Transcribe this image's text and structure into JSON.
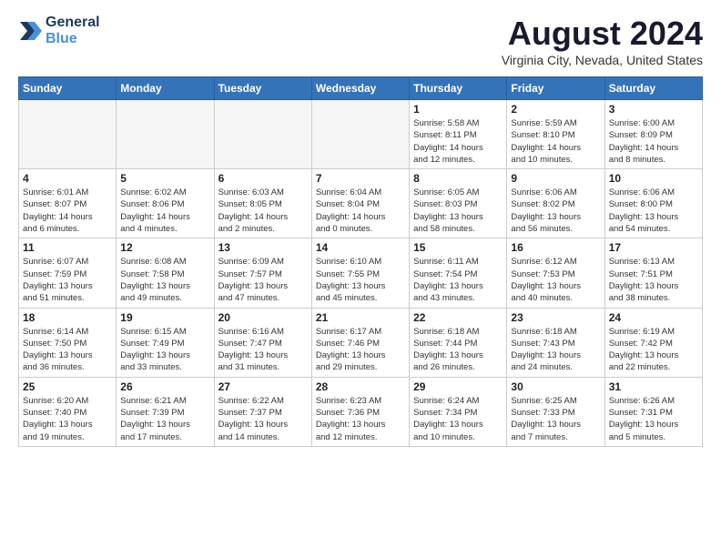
{
  "header": {
    "logo_line1": "General",
    "logo_line2": "Blue",
    "month": "August 2024",
    "location": "Virginia City, Nevada, United States"
  },
  "columns": [
    "Sunday",
    "Monday",
    "Tuesday",
    "Wednesday",
    "Thursday",
    "Friday",
    "Saturday"
  ],
  "weeks": [
    [
      {
        "num": "",
        "detail": "",
        "empty": true
      },
      {
        "num": "",
        "detail": "",
        "empty": true
      },
      {
        "num": "",
        "detail": "",
        "empty": true
      },
      {
        "num": "",
        "detail": "",
        "empty": true
      },
      {
        "num": "1",
        "detail": "Sunrise: 5:58 AM\nSunset: 8:11 PM\nDaylight: 14 hours\nand 12 minutes."
      },
      {
        "num": "2",
        "detail": "Sunrise: 5:59 AM\nSunset: 8:10 PM\nDaylight: 14 hours\nand 10 minutes."
      },
      {
        "num": "3",
        "detail": "Sunrise: 6:00 AM\nSunset: 8:09 PM\nDaylight: 14 hours\nand 8 minutes."
      }
    ],
    [
      {
        "num": "4",
        "detail": "Sunrise: 6:01 AM\nSunset: 8:07 PM\nDaylight: 14 hours\nand 6 minutes."
      },
      {
        "num": "5",
        "detail": "Sunrise: 6:02 AM\nSunset: 8:06 PM\nDaylight: 14 hours\nand 4 minutes."
      },
      {
        "num": "6",
        "detail": "Sunrise: 6:03 AM\nSunset: 8:05 PM\nDaylight: 14 hours\nand 2 minutes."
      },
      {
        "num": "7",
        "detail": "Sunrise: 6:04 AM\nSunset: 8:04 PM\nDaylight: 14 hours\nand 0 minutes."
      },
      {
        "num": "8",
        "detail": "Sunrise: 6:05 AM\nSunset: 8:03 PM\nDaylight: 13 hours\nand 58 minutes."
      },
      {
        "num": "9",
        "detail": "Sunrise: 6:06 AM\nSunset: 8:02 PM\nDaylight: 13 hours\nand 56 minutes."
      },
      {
        "num": "10",
        "detail": "Sunrise: 6:06 AM\nSunset: 8:00 PM\nDaylight: 13 hours\nand 54 minutes."
      }
    ],
    [
      {
        "num": "11",
        "detail": "Sunrise: 6:07 AM\nSunset: 7:59 PM\nDaylight: 13 hours\nand 51 minutes."
      },
      {
        "num": "12",
        "detail": "Sunrise: 6:08 AM\nSunset: 7:58 PM\nDaylight: 13 hours\nand 49 minutes."
      },
      {
        "num": "13",
        "detail": "Sunrise: 6:09 AM\nSunset: 7:57 PM\nDaylight: 13 hours\nand 47 minutes."
      },
      {
        "num": "14",
        "detail": "Sunrise: 6:10 AM\nSunset: 7:55 PM\nDaylight: 13 hours\nand 45 minutes."
      },
      {
        "num": "15",
        "detail": "Sunrise: 6:11 AM\nSunset: 7:54 PM\nDaylight: 13 hours\nand 43 minutes."
      },
      {
        "num": "16",
        "detail": "Sunrise: 6:12 AM\nSunset: 7:53 PM\nDaylight: 13 hours\nand 40 minutes."
      },
      {
        "num": "17",
        "detail": "Sunrise: 6:13 AM\nSunset: 7:51 PM\nDaylight: 13 hours\nand 38 minutes."
      }
    ],
    [
      {
        "num": "18",
        "detail": "Sunrise: 6:14 AM\nSunset: 7:50 PM\nDaylight: 13 hours\nand 36 minutes."
      },
      {
        "num": "19",
        "detail": "Sunrise: 6:15 AM\nSunset: 7:49 PM\nDaylight: 13 hours\nand 33 minutes."
      },
      {
        "num": "20",
        "detail": "Sunrise: 6:16 AM\nSunset: 7:47 PM\nDaylight: 13 hours\nand 31 minutes."
      },
      {
        "num": "21",
        "detail": "Sunrise: 6:17 AM\nSunset: 7:46 PM\nDaylight: 13 hours\nand 29 minutes."
      },
      {
        "num": "22",
        "detail": "Sunrise: 6:18 AM\nSunset: 7:44 PM\nDaylight: 13 hours\nand 26 minutes."
      },
      {
        "num": "23",
        "detail": "Sunrise: 6:18 AM\nSunset: 7:43 PM\nDaylight: 13 hours\nand 24 minutes."
      },
      {
        "num": "24",
        "detail": "Sunrise: 6:19 AM\nSunset: 7:42 PM\nDaylight: 13 hours\nand 22 minutes."
      }
    ],
    [
      {
        "num": "25",
        "detail": "Sunrise: 6:20 AM\nSunset: 7:40 PM\nDaylight: 13 hours\nand 19 minutes."
      },
      {
        "num": "26",
        "detail": "Sunrise: 6:21 AM\nSunset: 7:39 PM\nDaylight: 13 hours\nand 17 minutes."
      },
      {
        "num": "27",
        "detail": "Sunrise: 6:22 AM\nSunset: 7:37 PM\nDaylight: 13 hours\nand 14 minutes."
      },
      {
        "num": "28",
        "detail": "Sunrise: 6:23 AM\nSunset: 7:36 PM\nDaylight: 13 hours\nand 12 minutes."
      },
      {
        "num": "29",
        "detail": "Sunrise: 6:24 AM\nSunset: 7:34 PM\nDaylight: 13 hours\nand 10 minutes."
      },
      {
        "num": "30",
        "detail": "Sunrise: 6:25 AM\nSunset: 7:33 PM\nDaylight: 13 hours\nand 7 minutes."
      },
      {
        "num": "31",
        "detail": "Sunrise: 6:26 AM\nSunset: 7:31 PM\nDaylight: 13 hours\nand 5 minutes."
      }
    ]
  ]
}
